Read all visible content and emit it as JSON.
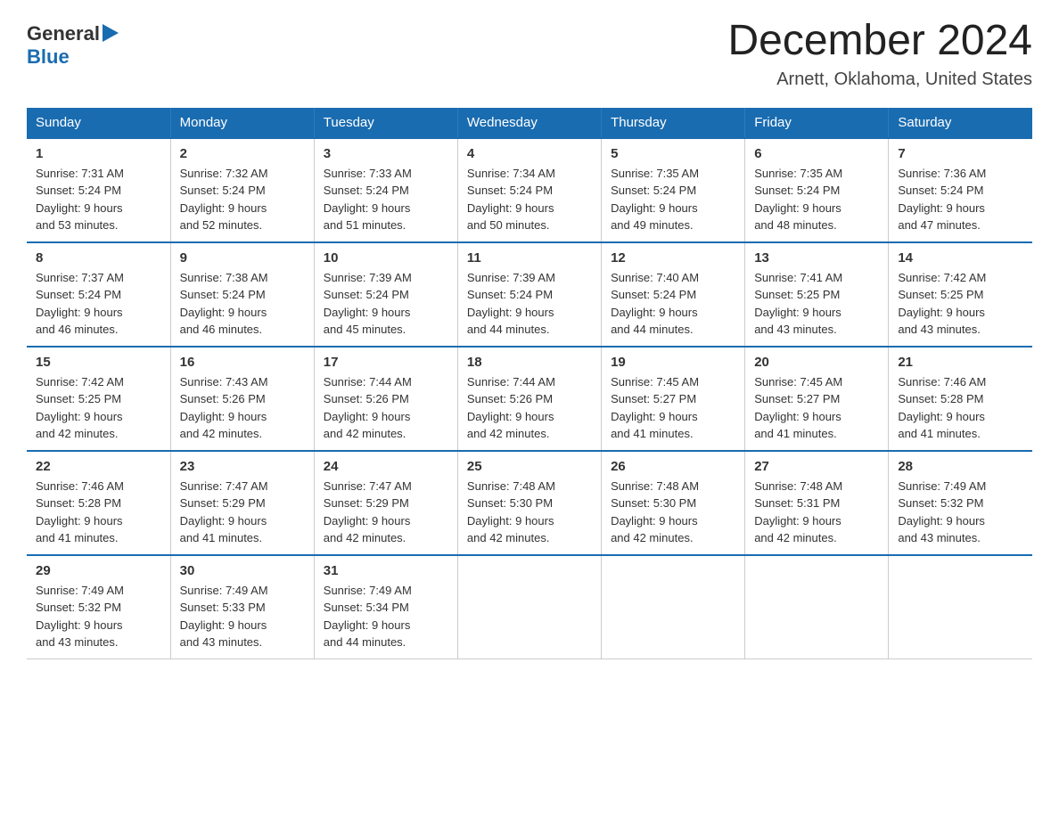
{
  "header": {
    "logo_general": "General",
    "logo_blue": "Blue",
    "title": "December 2024",
    "subtitle": "Arnett, Oklahoma, United States"
  },
  "days_of_week": [
    "Sunday",
    "Monday",
    "Tuesday",
    "Wednesday",
    "Thursday",
    "Friday",
    "Saturday"
  ],
  "weeks": [
    [
      {
        "day": "1",
        "sunrise": "7:31 AM",
        "sunset": "5:24 PM",
        "daylight": "9 hours and 53 minutes."
      },
      {
        "day": "2",
        "sunrise": "7:32 AM",
        "sunset": "5:24 PM",
        "daylight": "9 hours and 52 minutes."
      },
      {
        "day": "3",
        "sunrise": "7:33 AM",
        "sunset": "5:24 PM",
        "daylight": "9 hours and 51 minutes."
      },
      {
        "day": "4",
        "sunrise": "7:34 AM",
        "sunset": "5:24 PM",
        "daylight": "9 hours and 50 minutes."
      },
      {
        "day": "5",
        "sunrise": "7:35 AM",
        "sunset": "5:24 PM",
        "daylight": "9 hours and 49 minutes."
      },
      {
        "day": "6",
        "sunrise": "7:35 AM",
        "sunset": "5:24 PM",
        "daylight": "9 hours and 48 minutes."
      },
      {
        "day": "7",
        "sunrise": "7:36 AM",
        "sunset": "5:24 PM",
        "daylight": "9 hours and 47 minutes."
      }
    ],
    [
      {
        "day": "8",
        "sunrise": "7:37 AM",
        "sunset": "5:24 PM",
        "daylight": "9 hours and 46 minutes."
      },
      {
        "day": "9",
        "sunrise": "7:38 AM",
        "sunset": "5:24 PM",
        "daylight": "9 hours and 46 minutes."
      },
      {
        "day": "10",
        "sunrise": "7:39 AM",
        "sunset": "5:24 PM",
        "daylight": "9 hours and 45 minutes."
      },
      {
        "day": "11",
        "sunrise": "7:39 AM",
        "sunset": "5:24 PM",
        "daylight": "9 hours and 44 minutes."
      },
      {
        "day": "12",
        "sunrise": "7:40 AM",
        "sunset": "5:24 PM",
        "daylight": "9 hours and 44 minutes."
      },
      {
        "day": "13",
        "sunrise": "7:41 AM",
        "sunset": "5:25 PM",
        "daylight": "9 hours and 43 minutes."
      },
      {
        "day": "14",
        "sunrise": "7:42 AM",
        "sunset": "5:25 PM",
        "daylight": "9 hours and 43 minutes."
      }
    ],
    [
      {
        "day": "15",
        "sunrise": "7:42 AM",
        "sunset": "5:25 PM",
        "daylight": "9 hours and 42 minutes."
      },
      {
        "day": "16",
        "sunrise": "7:43 AM",
        "sunset": "5:26 PM",
        "daylight": "9 hours and 42 minutes."
      },
      {
        "day": "17",
        "sunrise": "7:44 AM",
        "sunset": "5:26 PM",
        "daylight": "9 hours and 42 minutes."
      },
      {
        "day": "18",
        "sunrise": "7:44 AM",
        "sunset": "5:26 PM",
        "daylight": "9 hours and 42 minutes."
      },
      {
        "day": "19",
        "sunrise": "7:45 AM",
        "sunset": "5:27 PM",
        "daylight": "9 hours and 41 minutes."
      },
      {
        "day": "20",
        "sunrise": "7:45 AM",
        "sunset": "5:27 PM",
        "daylight": "9 hours and 41 minutes."
      },
      {
        "day": "21",
        "sunrise": "7:46 AM",
        "sunset": "5:28 PM",
        "daylight": "9 hours and 41 minutes."
      }
    ],
    [
      {
        "day": "22",
        "sunrise": "7:46 AM",
        "sunset": "5:28 PM",
        "daylight": "9 hours and 41 minutes."
      },
      {
        "day": "23",
        "sunrise": "7:47 AM",
        "sunset": "5:29 PM",
        "daylight": "9 hours and 41 minutes."
      },
      {
        "day": "24",
        "sunrise": "7:47 AM",
        "sunset": "5:29 PM",
        "daylight": "9 hours and 42 minutes."
      },
      {
        "day": "25",
        "sunrise": "7:48 AM",
        "sunset": "5:30 PM",
        "daylight": "9 hours and 42 minutes."
      },
      {
        "day": "26",
        "sunrise": "7:48 AM",
        "sunset": "5:30 PM",
        "daylight": "9 hours and 42 minutes."
      },
      {
        "day": "27",
        "sunrise": "7:48 AM",
        "sunset": "5:31 PM",
        "daylight": "9 hours and 42 minutes."
      },
      {
        "day": "28",
        "sunrise": "7:49 AM",
        "sunset": "5:32 PM",
        "daylight": "9 hours and 43 minutes."
      }
    ],
    [
      {
        "day": "29",
        "sunrise": "7:49 AM",
        "sunset": "5:32 PM",
        "daylight": "9 hours and 43 minutes."
      },
      {
        "day": "30",
        "sunrise": "7:49 AM",
        "sunset": "5:33 PM",
        "daylight": "9 hours and 43 minutes."
      },
      {
        "day": "31",
        "sunrise": "7:49 AM",
        "sunset": "5:34 PM",
        "daylight": "9 hours and 44 minutes."
      },
      {
        "day": "",
        "sunrise": "",
        "sunset": "",
        "daylight": ""
      },
      {
        "day": "",
        "sunrise": "",
        "sunset": "",
        "daylight": ""
      },
      {
        "day": "",
        "sunrise": "",
        "sunset": "",
        "daylight": ""
      },
      {
        "day": "",
        "sunrise": "",
        "sunset": "",
        "daylight": ""
      }
    ]
  ],
  "labels": {
    "sunrise": "Sunrise:",
    "sunset": "Sunset:",
    "daylight": "Daylight:"
  }
}
